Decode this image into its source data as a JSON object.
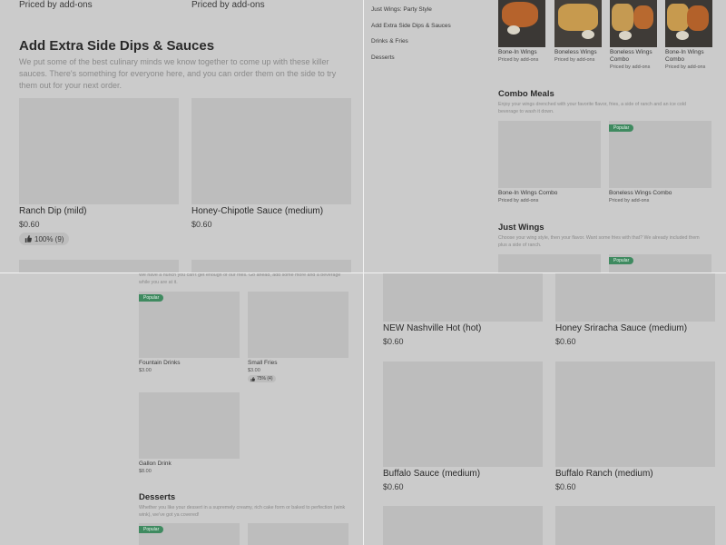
{
  "q1": {
    "top_priced_left": "Priced by add-ons",
    "top_priced_right": "Priced by add-ons",
    "section_title": "Add Extra Side Dips & Sauces",
    "section_desc": "We put some of the best culinary minds we know together to come up with these killer sauces. There's something for everyone here, and you can order them on the side to try them out for your next order.",
    "items": [
      {
        "name": "Ranch Dip (mild)",
        "price": "$0.60",
        "rating": "100% (9)"
      },
      {
        "name": "Honey-Chipotle Sauce (medium)",
        "price": "$0.60"
      }
    ]
  },
  "q2": {
    "nav": [
      "Just Wings: Party Style",
      "Add Extra Side Dips & Sauces",
      "Drinks & Fries",
      "Desserts"
    ],
    "top_items": [
      {
        "name": "Bone-In Wings",
        "sub": "Priced by add-ons"
      },
      {
        "name": "Boneless Wings",
        "sub": "Priced by add-ons"
      },
      {
        "name": "Boneless Wings Combo",
        "sub": "Priced by add-ons"
      },
      {
        "name": "Bone-In Wings Combo",
        "sub": "Priced by add-ons"
      }
    ],
    "combo_title": "Combo Meals",
    "combo_desc": "Enjoy your wings drenched with your favorite flavor, fries, a side of ranch and an ice cold beverage to wash it down.",
    "combo_items": [
      {
        "name": "Bone-In Wings Combo",
        "sub": "Priced by add-ons"
      },
      {
        "name": "Boneless Wings Combo",
        "sub": "Priced by add-ons",
        "badge": "Popular"
      }
    ],
    "wings_title": "Just Wings",
    "wings_desc": "Choose your wing style, then your flavor. Want some fries with that? We already included them plus a side of ranch.",
    "wings_badge": "Popular"
  },
  "q3": {
    "desc": "We have a hunch you can't get enough of our fries. Go ahead, add some more and a beverage while you are at it.",
    "items": [
      {
        "name": "Fountain Drinks",
        "price": "$3.00",
        "badge": "Popular"
      },
      {
        "name": "Small Fries",
        "price": "$3.00",
        "rating": "75% (4)"
      },
      {
        "name": "Gallon Drink",
        "price": "$8.00"
      }
    ],
    "desserts_title": "Desserts",
    "desserts_desc": "Whether you like your dessert in a supremely creamy, rich cake form or baked to perfection (wink wink), we've got ya covered!",
    "desserts_badge": "Popular"
  },
  "q4": {
    "items": [
      {
        "name": "NEW Nashville Hot (hot)",
        "price": "$0.60"
      },
      {
        "name": "Honey Sriracha Sauce (medium)",
        "price": "$0.60"
      },
      {
        "name": "Buffalo Sauce (medium)",
        "price": "$0.60"
      },
      {
        "name": "Buffalo Ranch (medium)",
        "price": "$0.60"
      }
    ]
  },
  "colors": {
    "background": "#cbcbcb",
    "placeholder": "#bdbdbd",
    "badge": "#3f8a60",
    "divider": "#f2f2f2"
  },
  "icons": [
    "thumbs-up-icon"
  ]
}
